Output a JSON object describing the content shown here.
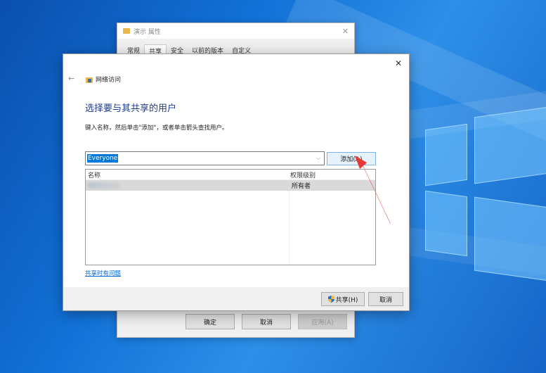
{
  "properties_window": {
    "title": "演示 属性",
    "tabs": [
      "常规",
      "共享",
      "安全",
      "以前的版本",
      "自定义"
    ],
    "active_tab": 1,
    "buttons": {
      "ok": "确定",
      "cancel": "取消",
      "apply": "应用(A)"
    }
  },
  "network_dialog": {
    "title": "网络访问",
    "heading": "选择要与其共享的用户",
    "instruction": "键入名称，然后单击\"添加\"，或者单击箭头查找用户。",
    "combo_value": "Everyone",
    "add_button": "添加(A)",
    "columns": {
      "name": "名称",
      "permission": "权限级别"
    },
    "rows": [
      {
        "permission": "所有者"
      }
    ],
    "help_link": "共享时有问题",
    "share_button": "共享(H)",
    "cancel_button": "取消"
  },
  "colors": {
    "accent": "#0078d7",
    "heading": "#1e3d8f",
    "annotation": "#e53935"
  }
}
